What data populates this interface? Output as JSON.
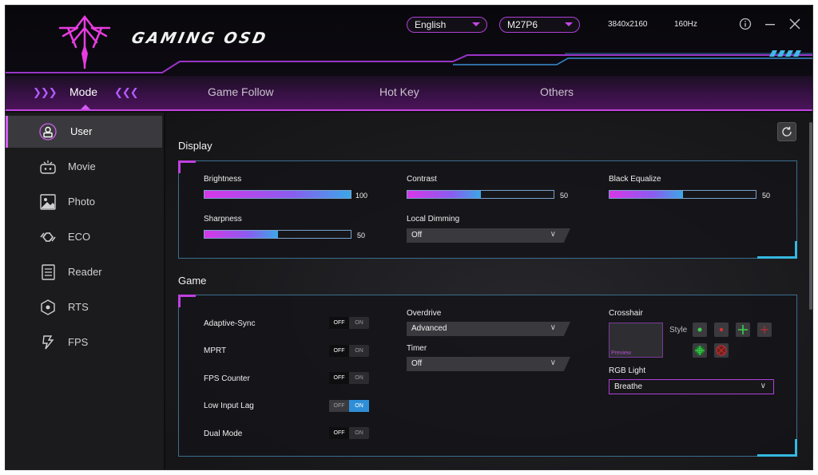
{
  "app": {
    "logo_text": "GAMING OSD"
  },
  "header": {
    "language": "English",
    "model": "M27P6",
    "resolution": "3840x2160",
    "refresh_rate": "160Hz",
    "info_icon": "info-icon",
    "minimize_icon": "minimize-icon",
    "close_icon": "close-icon"
  },
  "tabs": [
    {
      "label": "Mode",
      "active": true
    },
    {
      "label": "Game Follow",
      "active": false
    },
    {
      "label": "Hot Key",
      "active": false
    },
    {
      "label": "Others",
      "active": false
    }
  ],
  "sidebar": {
    "items": [
      {
        "label": "User",
        "icon": "user-icon",
        "active": true
      },
      {
        "label": "Movie",
        "icon": "movie-icon"
      },
      {
        "label": "Photo",
        "icon": "photo-icon"
      },
      {
        "label": "ECO",
        "icon": "eco-icon"
      },
      {
        "label": "Reader",
        "icon": "reader-icon"
      },
      {
        "label": "RTS",
        "icon": "rts-icon"
      },
      {
        "label": "FPS",
        "icon": "fps-icon"
      }
    ]
  },
  "display": {
    "title": "Display",
    "brightness": {
      "label": "Brightness",
      "value": "100",
      "fraction": 1.0
    },
    "contrast": {
      "label": "Contrast",
      "value": "50",
      "fraction": 0.5
    },
    "black_equalize": {
      "label": "Black Equalize",
      "value": "50",
      "fraction": 0.5
    },
    "sharpness": {
      "label": "Sharpness",
      "value": "50",
      "fraction": 0.5
    },
    "local_dimming": {
      "label": "Local Dimming",
      "value": "Off"
    }
  },
  "game": {
    "title": "Game",
    "toggle_off_text": "OFF",
    "toggle_on_text": "ON",
    "toggles": [
      {
        "label": "Adaptive-Sync",
        "on": false
      },
      {
        "label": "MPRT",
        "on": false
      },
      {
        "label": "FPS Counter",
        "on": false
      },
      {
        "label": "Low Input Lag",
        "on": true
      },
      {
        "label": "Dual Mode",
        "on": false
      }
    ],
    "overdrive": {
      "label": "Overdrive",
      "value": "Advanced"
    },
    "timer": {
      "label": "Timer",
      "value": "Off"
    },
    "crosshair": {
      "label": "Crosshair",
      "preview_label": "Preview",
      "style_label": "Style"
    },
    "rgb_light": {
      "label": "RGB Light",
      "value": "Breathe"
    }
  },
  "colors": {
    "accent_magenta": "#c040e0",
    "accent_cyan": "#35b8e0",
    "toggle_on": "#2f8ed8"
  }
}
